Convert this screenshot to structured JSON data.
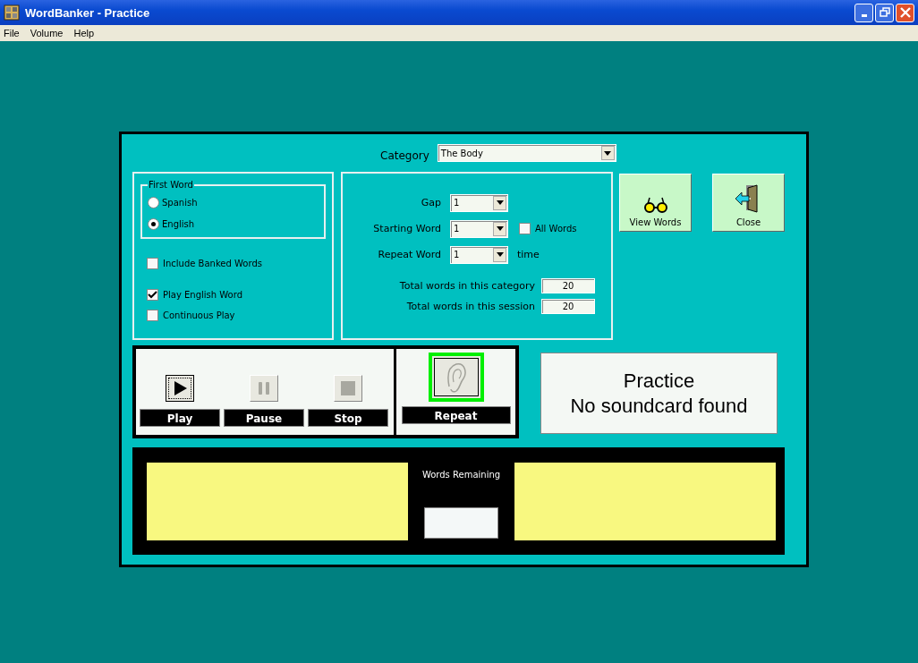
{
  "window": {
    "title": "WordBanker - Practice"
  },
  "menu": [
    "File",
    "Volume",
    "Help"
  ],
  "category": {
    "label": "Category",
    "value": "The Body"
  },
  "first_word": {
    "title": "First Word",
    "options": [
      {
        "label": "Spanish",
        "selected": false
      },
      {
        "label": "English",
        "selected": true
      }
    ]
  },
  "options": [
    {
      "label": "Include Banked Words",
      "checked": false
    },
    {
      "label": "Play English Word",
      "checked": true
    },
    {
      "label": "Continuous Play",
      "checked": false
    }
  ],
  "settings": {
    "gap": {
      "label": "Gap",
      "value": "1"
    },
    "starting_word": {
      "label": "Starting Word",
      "value": "1"
    },
    "all_words": {
      "label": "All Words",
      "checked": false
    },
    "repeat_word": {
      "label": "Repeat Word",
      "value": "1",
      "suffix": "time"
    },
    "totals": [
      {
        "label": "Total words in this category",
        "value": "20"
      },
      {
        "label": "Total words in this session",
        "value": "20"
      }
    ]
  },
  "buttons": [
    {
      "label": "View Words",
      "kind": "glasses"
    },
    {
      "label": "Close",
      "kind": "door"
    }
  ],
  "media": [
    {
      "label": "Play",
      "kind": "play",
      "disabled": false
    },
    {
      "label": "Pause",
      "kind": "pause",
      "disabled": true
    },
    {
      "label": "Stop",
      "kind": "stop",
      "disabled": true
    }
  ],
  "repeat": {
    "label": "Repeat"
  },
  "status": {
    "title": "Practice",
    "message": "No soundcard found"
  },
  "words_remaining": {
    "label": "Words Remaining"
  }
}
